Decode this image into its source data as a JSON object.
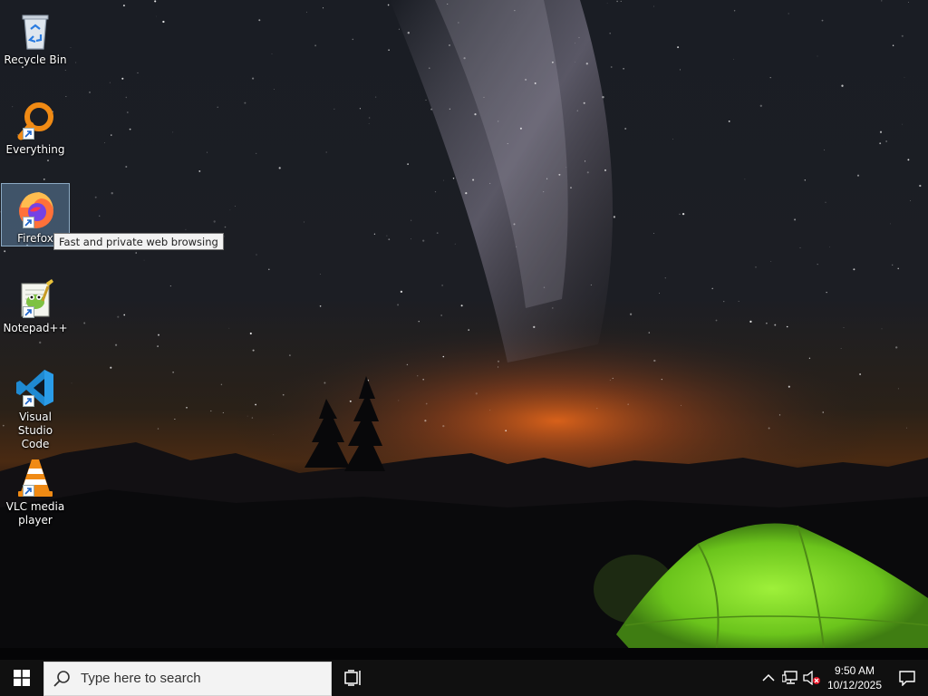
{
  "desktop": {
    "icons": [
      {
        "label": "Recycle Bin",
        "icon": "recycle-bin-icon",
        "shortcut": false
      },
      {
        "label": "Everything",
        "icon": "everything-search-icon",
        "shortcut": true
      },
      {
        "label": "Firefox",
        "icon": "firefox-icon",
        "shortcut": true,
        "selected": true
      },
      {
        "label": "Notepad++",
        "icon": "notepad-plus-plus-icon",
        "shortcut": true
      },
      {
        "label": "Visual Studio Code",
        "icon": "vscode-icon",
        "shortcut": true
      },
      {
        "label": "VLC media player",
        "icon": "vlc-icon",
        "shortcut": true
      }
    ],
    "tooltip": "Fast and private web browsing"
  },
  "taskbar": {
    "search_placeholder": "Type here to search",
    "clock": {
      "time": "9:50 AM",
      "date": "10/12/2025"
    },
    "tray_icons": [
      "chevron-up-icon",
      "network-icon",
      "volume-muted-icon"
    ]
  },
  "colors": {
    "taskbar_bg": "#101010",
    "selection": "#6e96be",
    "tent": "#7ed321"
  }
}
